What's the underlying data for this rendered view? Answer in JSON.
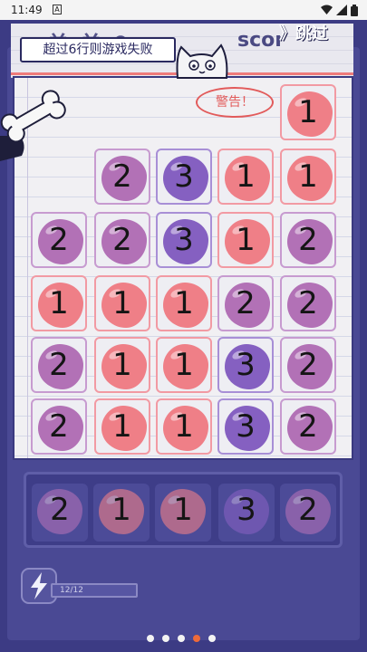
{
  "status_bar": {
    "time": "11:49",
    "notification_icon": "A",
    "icons": [
      "wifi-icon",
      "signal-icon",
      "battery-icon"
    ]
  },
  "header": {
    "rule_text": "超过6行则游戏失败",
    "skip_label": "》跳过",
    "faint_title": "单 单 0",
    "faint_score": "scor"
  },
  "warning_text": "警告！",
  "colors": {
    "pink": "#ef7f87",
    "mauve": "#b271b6",
    "purple": "#8560c1",
    "navy": "#3c3b84"
  },
  "board": {
    "rows": [
      [
        null,
        null,
        null,
        null,
        {
          "value": "1",
          "color": "pink"
        }
      ],
      [
        null,
        {
          "value": "2",
          "color": "mauve"
        },
        {
          "value": "3",
          "color": "purple"
        },
        {
          "value": "1",
          "color": "pink"
        },
        {
          "value": "1",
          "color": "pink"
        }
      ],
      [
        {
          "value": "2",
          "color": "mauve"
        },
        {
          "value": "2",
          "color": "mauve"
        },
        {
          "value": "3",
          "color": "purple"
        },
        {
          "value": "1",
          "color": "pink"
        },
        {
          "value": "2",
          "color": "mauve"
        }
      ],
      [
        {
          "value": "1",
          "color": "pink"
        },
        {
          "value": "1",
          "color": "pink"
        },
        {
          "value": "1",
          "color": "pink"
        },
        {
          "value": "2",
          "color": "mauve"
        },
        {
          "value": "2",
          "color": "mauve"
        }
      ],
      [
        {
          "value": "2",
          "color": "mauve"
        },
        {
          "value": "1",
          "color": "pink"
        },
        {
          "value": "1",
          "color": "pink"
        },
        {
          "value": "3",
          "color": "purple"
        },
        {
          "value": "2",
          "color": "mauve"
        }
      ],
      [
        {
          "value": "2",
          "color": "mauve"
        },
        {
          "value": "1",
          "color": "pink"
        },
        {
          "value": "1",
          "color": "pink"
        },
        {
          "value": "3",
          "color": "purple"
        },
        {
          "value": "2",
          "color": "mauve"
        }
      ]
    ]
  },
  "tray": [
    {
      "value": "2",
      "color": "mauve"
    },
    {
      "value": "1",
      "color": "pink"
    },
    {
      "value": "1",
      "color": "pink"
    },
    {
      "value": "3",
      "color": "purple"
    },
    {
      "value": "2",
      "color": "mauve"
    }
  ],
  "energy": {
    "text": "12/12",
    "fraction": 1.0
  },
  "pager": {
    "count": 5,
    "active_index": 3
  }
}
